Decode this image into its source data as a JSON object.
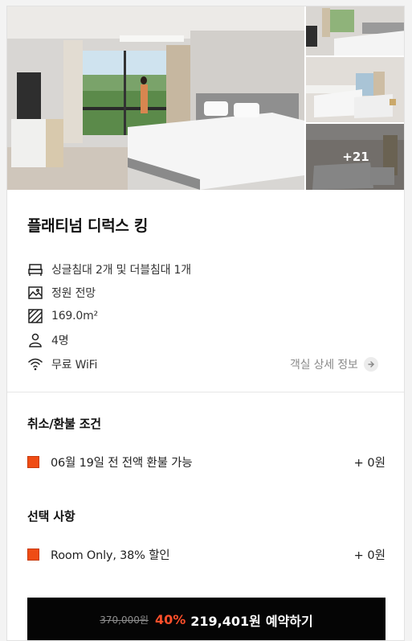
{
  "gallery": {
    "more_label": "+21"
  },
  "room": {
    "title": "플래티넘 디럭스 킹",
    "amenities": [
      {
        "icon": "bed-icon",
        "text": "싱글침대 2개 및 더블침대 1개"
      },
      {
        "icon": "landscape-icon",
        "text": "정원 전망"
      },
      {
        "icon": "area-icon",
        "text": "169.0m²"
      },
      {
        "icon": "person-icon",
        "text": "4명"
      },
      {
        "icon": "wifi-icon",
        "text": "무료 WiFi"
      }
    ],
    "detail_link": "객실 상세 정보"
  },
  "cancellation": {
    "title": "취소/환불 조건",
    "option": {
      "label": "06월 19일 전 전액 환불 가능",
      "price": "+ 0원"
    }
  },
  "options": {
    "title": "선택 사항",
    "option": {
      "label": "Room Only, 38% 할인",
      "price": "+ 0원"
    }
  },
  "booking": {
    "original_price": "370,000원",
    "discount": "40%",
    "final_price": "219,401원",
    "cta": "예약하기"
  },
  "colors": {
    "accent": "#ef4c14",
    "discount": "#ff4f2a",
    "button_bg": "#050505"
  }
}
